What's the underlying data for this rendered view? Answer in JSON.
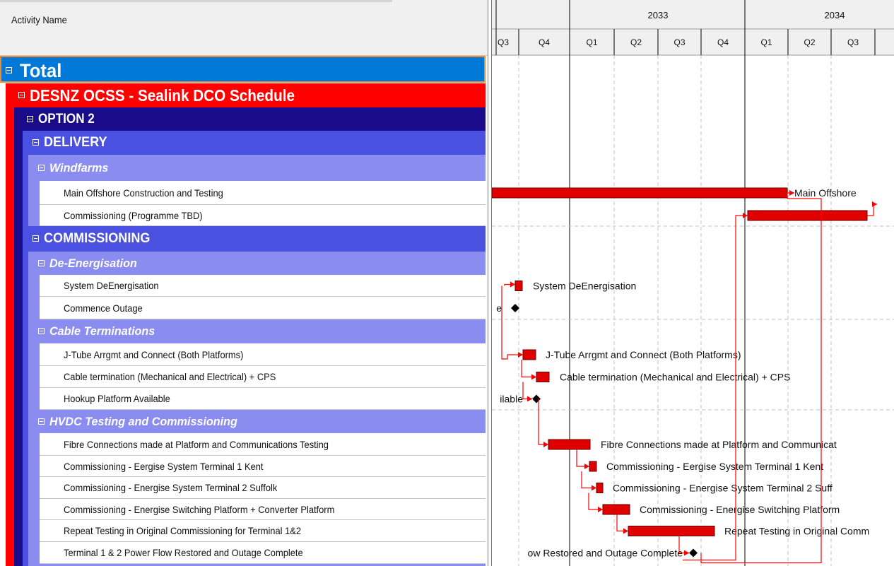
{
  "header": {
    "activity_name": "Activity Name"
  },
  "timeline": {
    "years": [
      {
        "label": "2033"
      },
      {
        "label": "2034"
      }
    ],
    "quarters": [
      "Q3",
      "Q4",
      "Q1",
      "Q2",
      "Q3",
      "Q4",
      "Q1",
      "Q2",
      "Q3"
    ]
  },
  "rows": [
    {
      "id": "total",
      "label": "Total",
      "level": 0
    },
    {
      "id": "schedule",
      "label": "DESNZ OCSS - Sealink DCO Schedule",
      "level": 1
    },
    {
      "id": "option2",
      "label": "OPTION 2",
      "level": 2
    },
    {
      "id": "delivery",
      "label": "DELIVERY",
      "level": 3
    },
    {
      "id": "windfarms",
      "label": "Windfarms",
      "level": 4
    },
    {
      "id": "main-offshore",
      "label": "Main Offshore Construction and Testing",
      "level": 5,
      "bar_label": "Main Offshore"
    },
    {
      "id": "commissioning-tbd",
      "label": "Commissioning (Programme TBD)",
      "level": 5,
      "bar_label": ""
    },
    {
      "id": "commissioning",
      "label": "COMMISSIONING",
      "level": 3
    },
    {
      "id": "de-energisation",
      "label": "De-Energisation",
      "level": 4
    },
    {
      "id": "system-deenergisation",
      "label": "System DeEnergisation",
      "level": 5,
      "bar_label": "System DeEnergisation"
    },
    {
      "id": "commence-outage",
      "label": "Commence Outage",
      "level": 5,
      "bar_label": "e",
      "milestone": true
    },
    {
      "id": "cable-terminations",
      "label": "Cable Terminations",
      "level": 4
    },
    {
      "id": "j-tube",
      "label": "J-Tube Arrgmt and Connect (Both Platforms)",
      "level": 5,
      "bar_label": "J-Tube Arrgmt and Connect (Both Platforms)"
    },
    {
      "id": "cable-termination",
      "label": "Cable termination (Mechanical and Electrical) + CPS",
      "level": 5,
      "bar_label": "Cable termination (Mechanical and Electrical) + CPS"
    },
    {
      "id": "hookup-platform",
      "label": "Hookup Platform Available",
      "level": 5,
      "bar_label": "ilable",
      "milestone": true
    },
    {
      "id": "hvdc",
      "label": "HVDC Testing and Commissioning",
      "level": 4
    },
    {
      "id": "fibre",
      "label": "Fibre Connections made at Platform and Communications Testing",
      "level": 5,
      "bar_label": "Fibre Connections made at Platform and Communicat"
    },
    {
      "id": "terminal1",
      "label": "Commissioning - Eergise System Terminal 1 Kent",
      "level": 5,
      "bar_label": "Commissioning - Eergise System Terminal 1 Kent"
    },
    {
      "id": "terminal2",
      "label": "Commissioning - Energise System Terminal 2 Suffolk",
      "level": 5,
      "bar_label": "Commissioning - Energise System Terminal 2 Suff"
    },
    {
      "id": "switching",
      "label": "Commissioning - Energise Switching Platform + Converter Platform",
      "level": 5,
      "bar_label": "Commissioning - Energise Switching Platform"
    },
    {
      "id": "repeat-testing",
      "label": "Repeat Testing in Original Commissioning for Terminal 1&2",
      "level": 5,
      "bar_label": "Repeat Testing in Original Comm"
    },
    {
      "id": "power-flow",
      "label": "Terminal 1 & 2 Power Flow Restored and Outage Complete",
      "level": 5,
      "bar_label": "ow Restored and Outage Complete",
      "milestone": true
    }
  ],
  "colors": {
    "total": "#0078d7",
    "schedule": "#ff0000",
    "option2": "#1a0a8c",
    "delivery": "#4a50e0",
    "group": "#8a8cf0",
    "bar": "#e00000",
    "link": "#ff0000",
    "milestone": "#000000",
    "gridline": "#c0c0c0"
  }
}
